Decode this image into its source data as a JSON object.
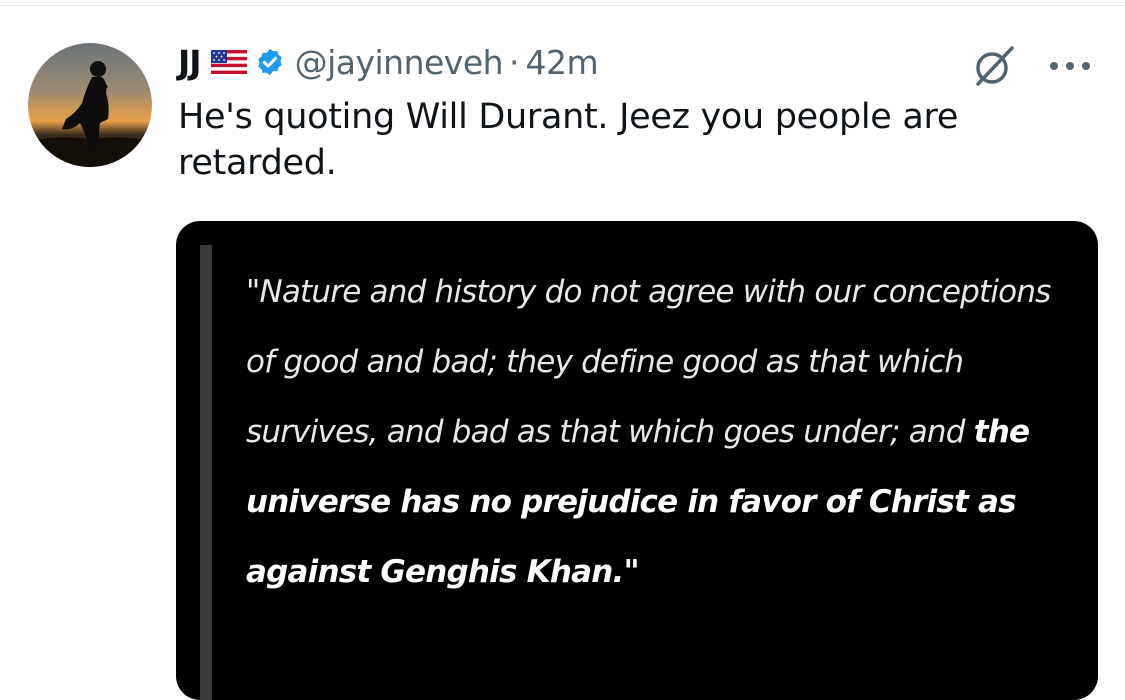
{
  "tweet": {
    "display_name": "JJ",
    "handle": "@jayinneveh",
    "separator": "·",
    "time": "42m",
    "text": "He's quoting Will Durant. Jeez you people are retarded.",
    "icons": {
      "flag": "us-flag-icon",
      "verified": "verified-badge-icon",
      "grok": "grok-icon",
      "more": "more-options-icon"
    },
    "colors": {
      "verified": "#1d9bf0",
      "secondary_text": "#536471",
      "primary_text": "#0f1419"
    }
  },
  "media": {
    "quote_normal": "\"Nature and history do not agree with our conceptions of good and bad; they define good as that which survives, and bad as that which goes under; and",
    "quote_bold": "the universe has no prejudice in favor of Christ as against Genghis Khan.\"",
    "background": "#000000"
  }
}
